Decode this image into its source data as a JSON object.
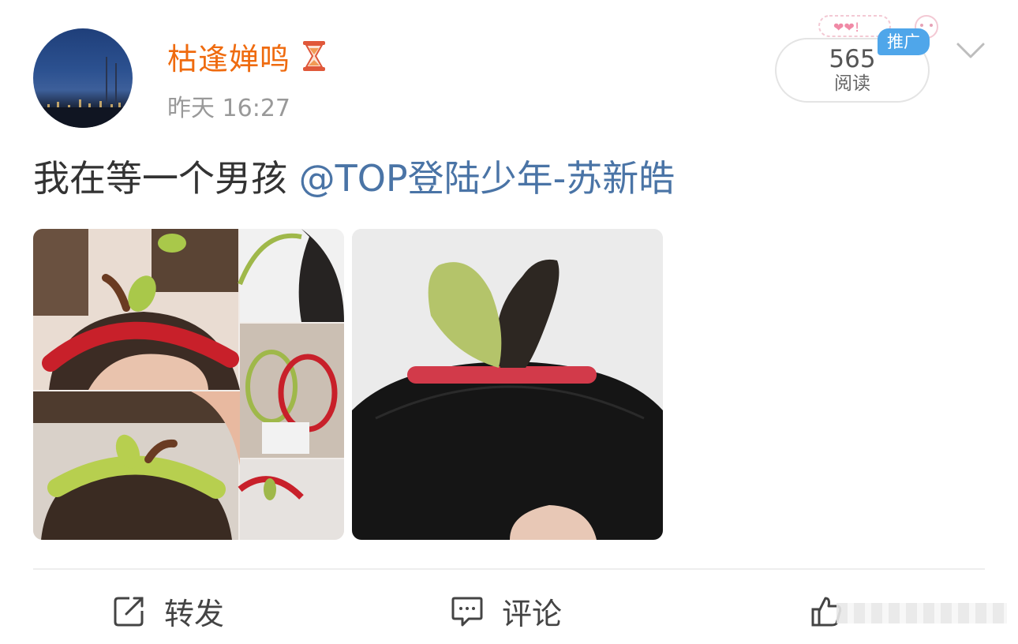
{
  "post": {
    "author": {
      "name": "枯逢婵鸣",
      "badge_icon": "hourglass-icon"
    },
    "time": "昨天 16:27",
    "reads": {
      "count": "565",
      "label": "阅读"
    },
    "promo_tag": "推广",
    "text": {
      "body": "我在等一个男孩",
      "mention": "@TOP登陆少年-苏新皓"
    },
    "images": [
      {
        "icon": "headband-collage-image"
      },
      {
        "icon": "sprout-hairclip-image"
      }
    ],
    "actions": [
      {
        "label": "转发",
        "icon": "repost-icon"
      },
      {
        "label": "评论",
        "icon": "comment-icon"
      },
      {
        "label": "",
        "icon": "like-icon"
      }
    ]
  },
  "colors": {
    "username": "#ef6b0f",
    "mention": "#4a74a6",
    "timestamp": "#999999",
    "promo": "#4fa6ea"
  }
}
